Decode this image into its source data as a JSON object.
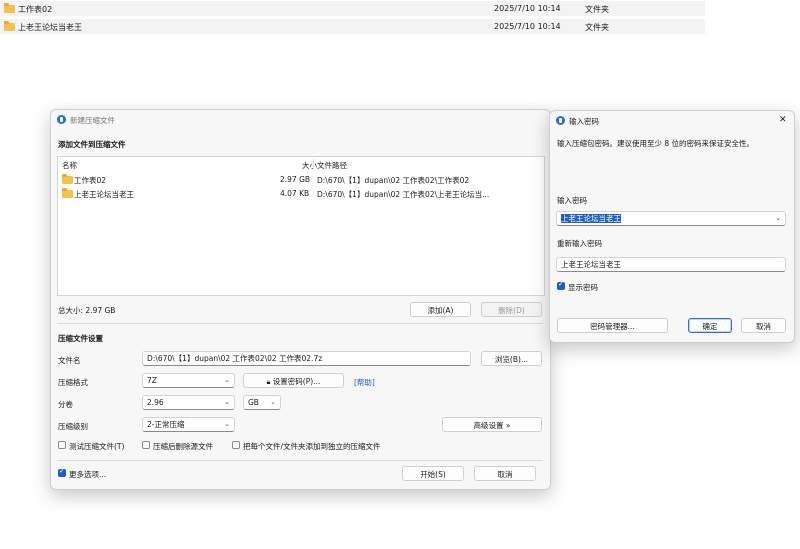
{
  "explorer": {
    "rows": [
      {
        "name": "工作表02",
        "date": "2025/7/10 10:14",
        "type": "文件夹"
      },
      {
        "name": "上老王论坛当老王",
        "date": "2025/7/10 10:14",
        "type": "文件夹"
      }
    ]
  },
  "archive_dialog": {
    "title": "新建压缩文件",
    "add_section_title": "添加文件到压缩文件",
    "columns": {
      "name": "名称",
      "size": "大小",
      "path": "文件路径"
    },
    "files": [
      {
        "name": "工作表02",
        "size": "2.97 GB",
        "path": "D:\\670\\【1】dupan\\02 工作表02\\工作表02"
      },
      {
        "name": "上老王论坛当老王",
        "size": "4.07 KB",
        "path": "D:\\670\\【1】dupan\\02 工作表02\\上老王论坛当..."
      }
    ],
    "total_size": "总大小: 2.97 GB",
    "add_button": "添加(A)",
    "delete_button": "删除(D)",
    "settings_title": "压缩文件设置",
    "filename_label": "文件名",
    "filename_value": "D:\\670\\【1】dupan\\02 工作表02\\02 工作表02.7z",
    "browse_button": "浏览(B)...",
    "format_label": "压缩格式",
    "format_value": "7Z",
    "set_password_button": "设置密码(P)...",
    "help_link": "[帮助]",
    "volume_label": "分卷",
    "volume_value": "2.96",
    "volume_unit": "GB",
    "level_label": "压缩级别",
    "level_value": "2-正常压缩",
    "advanced_button": "高级设置 »",
    "options": {
      "test": "测试压缩文件(T)",
      "delete_source": "压缩后删除源文件",
      "separate": "把每个文件/文件夹添加到独立的压缩文件"
    },
    "more_options": "更多选项...",
    "start_button": "开始(S)",
    "cancel_button": "取消"
  },
  "password_dialog": {
    "title": "输入密码",
    "close_glyph": "✕",
    "instruction": "输入压缩包密码。建议使用至少 8 位的密码来保证安全性。",
    "password_label": "输入密码",
    "password_value": "上老王论坛当老王",
    "confirm_label": "重新输入密码",
    "confirm_value": "上老王论坛当老王",
    "show_password": "显示密码",
    "manager_button": "密码管理器...",
    "ok_button": "确定",
    "cancel_button": "取消"
  }
}
